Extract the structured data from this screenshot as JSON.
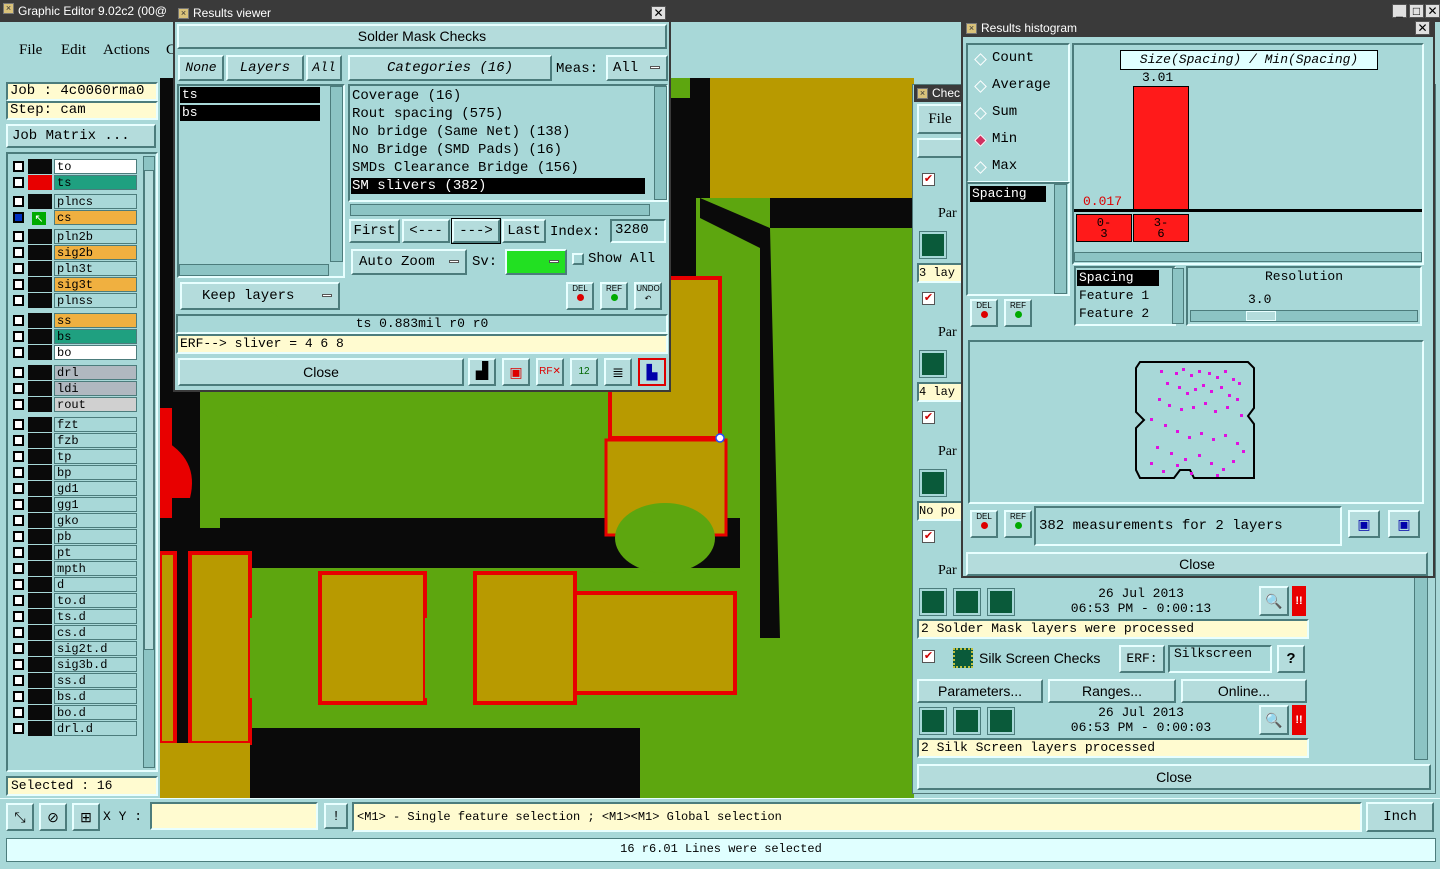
{
  "main_window": {
    "title": "Graphic Editor 9.02c2 (00@",
    "menu": [
      "File",
      "Edit",
      "Actions",
      "C"
    ],
    "job_label": "Job : 4c0060rma0",
    "step_label": "Step: cam",
    "job_matrix_button": "Job Matrix ...",
    "selected_label": "Selected : 16",
    "xy_label": "X Y :",
    "message": "<M1> - Single feature selection ; <M1><M1> Global selection",
    "units": "Inch",
    "status": "16 r6.01 Lines were selected"
  },
  "layers": [
    {
      "name": "to",
      "color": "#ffffff",
      "mark": "#0a0a0a"
    },
    {
      "name": "ts",
      "color": "#1fa080",
      "mark": "#e80000"
    },
    {
      "name": "plncs",
      "color": "#a8d8d8",
      "mark": "#0a0a0a"
    },
    {
      "name": "cs",
      "color": "#f0b040",
      "mark": "#0a0a0a"
    },
    {
      "name": "pln2b",
      "color": "#a8d8d8",
      "mark": "#0a0a0a"
    },
    {
      "name": "sig2b",
      "color": "#f0b040",
      "mark": "#0a0a0a"
    },
    {
      "name": "pln3t",
      "color": "#a8d8d8",
      "mark": "#0a0a0a"
    },
    {
      "name": "sig3t",
      "color": "#f0b040",
      "mark": "#0a0a0a"
    },
    {
      "name": "plnss",
      "color": "#a8d8d8",
      "mark": "#0a0a0a"
    },
    {
      "name": "ss",
      "color": "#f0b040",
      "mark": "#0a0a0a"
    },
    {
      "name": "bs",
      "color": "#1fa080",
      "mark": "#0a0a0a"
    },
    {
      "name": "bo",
      "color": "#ffffff",
      "mark": "#0a0a0a"
    },
    {
      "name": "drl",
      "color": "#b0b8c0",
      "mark": "#0a0a0a"
    },
    {
      "name": "ldi",
      "color": "#b0b8c0",
      "mark": "#0a0a0a"
    },
    {
      "name": "rout",
      "color": "#d0d0d0",
      "mark": "#0a0a0a"
    },
    {
      "name": "fzt",
      "color": "#a8d8d8",
      "mark": "#0a0a0a"
    },
    {
      "name": "fzb",
      "color": "#a8d8d8",
      "mark": "#0a0a0a"
    },
    {
      "name": "tp",
      "color": "#a8d8d8",
      "mark": "#0a0a0a"
    },
    {
      "name": "bp",
      "color": "#a8d8d8",
      "mark": "#0a0a0a"
    },
    {
      "name": "gd1",
      "color": "#a8d8d8",
      "mark": "#0a0a0a"
    },
    {
      "name": "gg1",
      "color": "#a8d8d8",
      "mark": "#0a0a0a"
    },
    {
      "name": "gko",
      "color": "#a8d8d8",
      "mark": "#0a0a0a"
    },
    {
      "name": "pb",
      "color": "#a8d8d8",
      "mark": "#0a0a0a"
    },
    {
      "name": "pt",
      "color": "#a8d8d8",
      "mark": "#0a0a0a"
    },
    {
      "name": "mpth",
      "color": "#a8d8d8",
      "mark": "#0a0a0a"
    },
    {
      "name": "d",
      "color": "#a8d8d8",
      "mark": "#0a0a0a"
    },
    {
      "name": "to.d",
      "color": "#a8d8d8",
      "mark": "#0a0a0a"
    },
    {
      "name": "ts.d",
      "color": "#a8d8d8",
      "mark": "#0a0a0a"
    },
    {
      "name": "cs.d",
      "color": "#a8d8d8",
      "mark": "#0a0a0a"
    },
    {
      "name": "sig2t.d",
      "color": "#a8d8d8",
      "mark": "#0a0a0a"
    },
    {
      "name": "sig3b.d",
      "color": "#a8d8d8",
      "mark": "#0a0a0a"
    },
    {
      "name": "ss.d",
      "color": "#a8d8d8",
      "mark": "#0a0a0a"
    },
    {
      "name": "bs.d",
      "color": "#a8d8d8",
      "mark": "#0a0a0a"
    },
    {
      "name": "bo.d",
      "color": "#a8d8d8",
      "mark": "#0a0a0a"
    },
    {
      "name": "drl.d",
      "color": "#a8d8d8",
      "mark": "#0a0a0a"
    }
  ],
  "results_viewer": {
    "title": "Results viewer",
    "heading": "Solder Mask Checks",
    "none": "None",
    "layers_btn": "Layers",
    "all": "All",
    "categories_btn": "Categories (16)",
    "meas_label": "Meas:",
    "meas_value": "All",
    "layer_list": [
      "ts",
      "bs"
    ],
    "categories": [
      "Coverage (16)",
      "Rout spacing (575)",
      "No bridge (Same Net) (138)",
      "No Bridge (SMD Pads) (16)",
      "SMDs Clearance Bridge (156)",
      "SM slivers (382)"
    ],
    "first": "First",
    "prev": "<---",
    "next": "--->",
    "last": "Last",
    "index_label": "Index:",
    "index_value": "3280",
    "auto_zoom": "Auto Zoom",
    "sv_label": "Sv:",
    "show_all": "Show All",
    "keep_layers": "Keep layers",
    "info": "ts 0.883mil  r0  r0",
    "erf": "ERF--> sliver = 4 6 8",
    "close": "Close",
    "del": "DEL",
    "ref": "REF",
    "undo": "UNDO"
  },
  "histogram": {
    "title": "Results histogram",
    "options": [
      "Count",
      "Average",
      "Sum",
      "Min",
      "Max"
    ],
    "selected_option": "Min",
    "formula": "Size(Spacing) / Min(Spacing)",
    "max_value": "3.01",
    "min_value": "0.017",
    "bins": [
      "0-3",
      "3-6"
    ],
    "list": [
      "Spacing"
    ],
    "right_list": [
      "Spacing",
      "Feature 1",
      "Feature 2"
    ],
    "resolution_label": "Resolution",
    "resolution_value": "3.0",
    "summary": "382 measurements for 2 layers",
    "close": "Close",
    "del": "DEL",
    "ref": "REF"
  },
  "checklist": {
    "title": "Chec",
    "menu_file": "File",
    "par_label": "Par",
    "lay_labels": [
      "3 lay",
      "4 lay"
    ],
    "no_po": "No po",
    "date1": "26 Jul 2013",
    "time1": "06:53 PM - 0:00:13",
    "msg1": "2 Solder Mask layers were processed",
    "silk_title": "Silk Screen Checks",
    "erf_label": "ERF:",
    "erf_value": "Silkscreen",
    "help": "?",
    "params": "Parameters...",
    "ranges": "Ranges...",
    "online": "Online...",
    "date2": "26 Jul 2013",
    "time2": "06:53 PM - 0:00:03",
    "msg2": "2 Silk Screen layers processed",
    "close": "Close",
    "alert": "!!"
  }
}
